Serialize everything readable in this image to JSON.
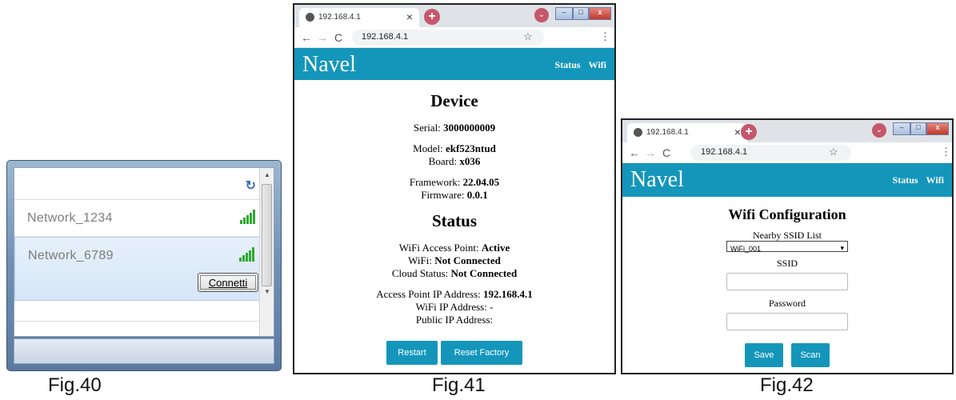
{
  "fig40": {
    "networks": [
      {
        "name": "Network_1234"
      },
      {
        "name": "Network_6789",
        "connect_label": "Connetti"
      }
    ],
    "caption": "Fig.40"
  },
  "fig41": {
    "tab_title": "192.168.4.1",
    "url": "192.168.4.1",
    "brand": "Navel",
    "nav": {
      "status": "Status",
      "wifi": "Wifi"
    },
    "device": {
      "heading": "Device",
      "serial_label": "Serial:",
      "serial": "3000000009",
      "model_label": "Model:",
      "model": "ekf523ntud",
      "board_label": "Board:",
      "board": "x036",
      "framework_label": "Framework:",
      "framework": "22.04.05",
      "firmware_label": "Firmware:",
      "firmware": "0.0.1"
    },
    "status": {
      "heading": "Status",
      "ap_label": "WiFi Access Point:",
      "ap": "Active",
      "wifi_label": "WiFi:",
      "wifi": "Not Connected",
      "cloud_label": "Cloud Status:",
      "cloud": "Not Connected",
      "ap_ip_label": "Access Point IP Address:",
      "ap_ip": "192.168.4.1",
      "wifi_ip_label": "WiFi IP Address: -",
      "public_ip_label": "Public IP Address:"
    },
    "buttons": {
      "restart": "Restart",
      "reset": "Reset Factory"
    },
    "caption": "Fig.41"
  },
  "fig42": {
    "tab_title": "192.168.4.1",
    "url": "192.168.4.1",
    "brand": "Navel",
    "nav": {
      "status": "Status",
      "wifi": "Wifi"
    },
    "heading": "Wifi Configuration",
    "ssid_list_label": "Nearby SSID List",
    "ssid_selected": "WiFi_001",
    "ssid_label": "SSID",
    "password_label": "Password",
    "buttons": {
      "save": "Save",
      "scan": "Scan"
    },
    "caption": "Fig.42"
  }
}
